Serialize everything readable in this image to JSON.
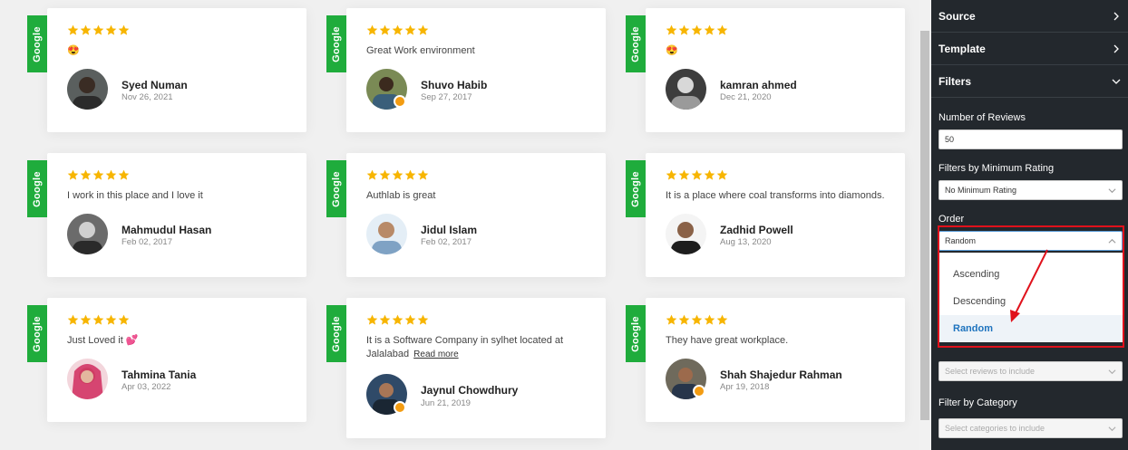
{
  "badge_text": "Google",
  "reviews": [
    {
      "text": "😍",
      "name": "Syed Numan",
      "date": "Nov 26, 2021"
    },
    {
      "text": "Great Work environment",
      "name": "Shuvo Habib",
      "date": "Sep 27, 2017"
    },
    {
      "text": "😍",
      "name": "kamran ahmed",
      "date": "Dec 21, 2020"
    },
    {
      "text": "I work in this place and I love it",
      "name": "Mahmudul Hasan",
      "date": "Feb 02, 2017"
    },
    {
      "text": "Authlab is great",
      "name": "Jidul Islam",
      "date": "Feb 02, 2017"
    },
    {
      "text": "It is a place where coal transforms into diamonds.",
      "name": "Zadhid Powell",
      "date": "Aug 13, 2020"
    },
    {
      "text": "Just Loved it 💕",
      "name": "Tahmina Tania",
      "date": "Apr 03, 2022"
    },
    {
      "text": "It is a Software Company in sylhet located at Jalalabad",
      "read_more": "Read more",
      "name": "Jaynul Chowdhury",
      "date": "Jun 21, 2019"
    },
    {
      "text": "They have great workplace.",
      "name": "Shah Shajedur Rahman",
      "date": "Apr 19, 2018"
    }
  ],
  "rating": 5,
  "star_color": "#f7b500",
  "badge_color": "#1fac3c",
  "panel": {
    "sections": [
      "Source",
      "Template",
      "Filters"
    ],
    "number_of_reviews_label": "Number of Reviews",
    "number_of_reviews_value": "50",
    "min_rating_label": "Filters by Minimum Rating",
    "min_rating_value": "No Minimum Rating",
    "order_label": "Order",
    "order_value": "Random",
    "order_options": [
      "Ascending",
      "Descending",
      "Random"
    ],
    "include_placeholder": "Select reviews to include",
    "category_label": "Filter by Category",
    "category_placeholder": "Select categories to include"
  },
  "highlight_color": "#e0111b"
}
